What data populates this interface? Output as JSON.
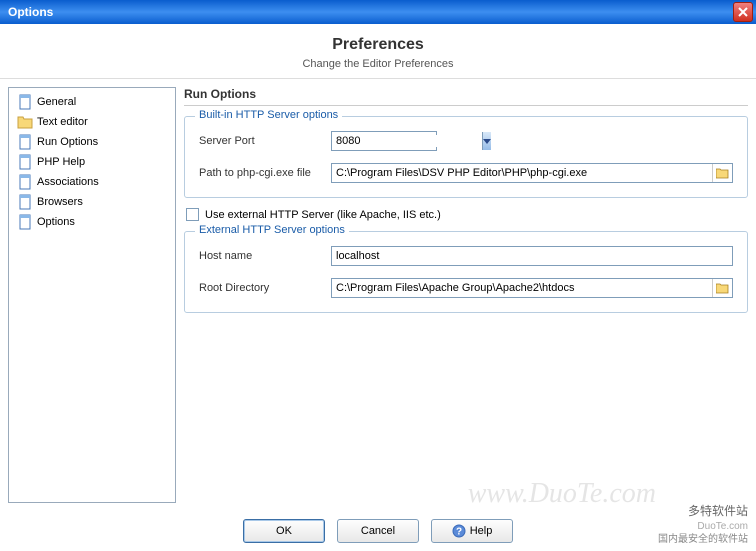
{
  "titlebar": {
    "text": "Options"
  },
  "header": {
    "title": "Preferences",
    "subtitle": "Change the Editor Preferences"
  },
  "sidebar": {
    "items": [
      {
        "label": "General",
        "icon": "page"
      },
      {
        "label": "Text editor",
        "icon": "folder"
      },
      {
        "label": "Run Options",
        "icon": "page"
      },
      {
        "label": "PHP Help",
        "icon": "page"
      },
      {
        "label": "Associations",
        "icon": "page"
      },
      {
        "label": "Browsers",
        "icon": "page"
      },
      {
        "label": "Options",
        "icon": "page"
      }
    ]
  },
  "main": {
    "section_title": "Run Options",
    "builtin": {
      "legend": "Built-in HTTP Server options",
      "port_label": "Server Port",
      "port_value": "8080",
      "path_label": "Path to php-cgi.exe file",
      "path_value": "C:\\Program Files\\DSV PHP Editor\\PHP\\php-cgi.exe"
    },
    "use_external_label": "Use external HTTP Server (like Apache, IIS etc.)",
    "external": {
      "legend": "External HTTP Server options",
      "host_label": "Host name",
      "host_value": "localhost",
      "root_label": "Root Directory",
      "root_value": "C:\\Program Files\\Apache Group\\Apache2\\htdocs"
    }
  },
  "buttons": {
    "ok": "OK",
    "cancel": "Cancel",
    "help": "Help"
  },
  "watermark": {
    "center": "www.DuoTe.com",
    "corner_logo": "多特软件站",
    "corner_en": "DuoTe.com",
    "corner_cn": "国内最安全的软件站"
  }
}
